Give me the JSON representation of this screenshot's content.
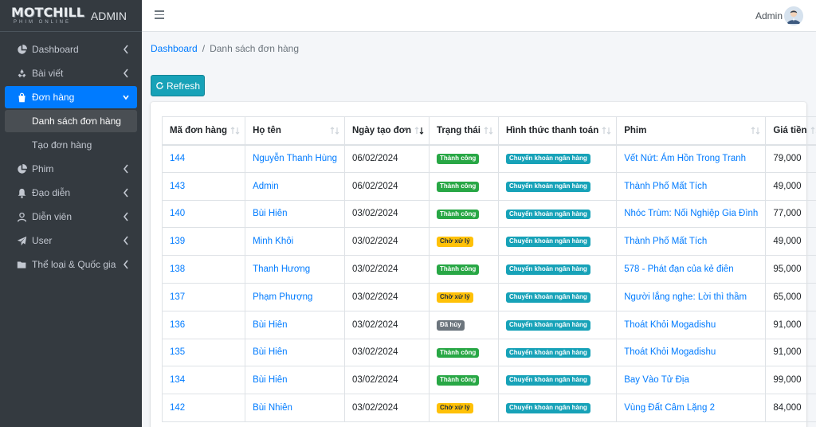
{
  "brand": {
    "logo_main": "MOTCHILL",
    "logo_sub": "PHIM ONLINE",
    "title": "ADMIN"
  },
  "topbar": {
    "user_name": "Admin"
  },
  "sidebar": {
    "items": [
      {
        "label": "Dashboard",
        "icon": "pie-chart-icon"
      },
      {
        "label": "Bài viết",
        "icon": "recycle-icon"
      },
      {
        "label": "Đơn hàng",
        "icon": "shopping-bag-icon",
        "active": true,
        "children": [
          {
            "label": "Danh sách đơn hàng",
            "active": true
          },
          {
            "label": "Tạo đơn hàng"
          }
        ]
      },
      {
        "label": "Phim",
        "icon": "pie-chart-icon"
      },
      {
        "label": "Đạo diễn",
        "icon": "bell-icon"
      },
      {
        "label": "Diễn viên",
        "icon": "user-icon"
      },
      {
        "label": "User",
        "icon": "paper-plane-icon"
      },
      {
        "label": "Thể loại & Quốc gia",
        "icon": "folder-icon"
      }
    ]
  },
  "breadcrumb": {
    "home": "Dashboard",
    "separator": "/",
    "current": "Danh sách đơn hàng"
  },
  "actions": {
    "refresh_label": "Refresh"
  },
  "table": {
    "headers": [
      "Mã đơn hàng",
      "Họ tên",
      "Ngày tạo đơn",
      "Trạng thái",
      "Hình thức thanh toán",
      "Phim",
      "Giá tiền"
    ],
    "rows": [
      {
        "id": "144",
        "name": "Nguyễn Thanh Hùng",
        "date": "06/02/2024",
        "status": "Thành công",
        "status_type": "success",
        "payment": "Chuyển khoản ngân hàng",
        "movie": "Vết Nứt: Ám Hồn Trong Tranh",
        "price": "79,000"
      },
      {
        "id": "143",
        "name": "Admin",
        "date": "06/02/2024",
        "status": "Thành công",
        "status_type": "success",
        "payment": "Chuyển khoản ngân hàng",
        "movie": "Thành Phố Mất Tích",
        "price": "49,000"
      },
      {
        "id": "140",
        "name": "Bùi Hiên",
        "date": "03/02/2024",
        "status": "Thành công",
        "status_type": "success",
        "payment": "Chuyển khoản ngân hàng",
        "movie": "Nhóc Trùm: Nối Nghiệp Gia Đình",
        "price": "77,000"
      },
      {
        "id": "139",
        "name": "Minh Khôi",
        "date": "03/02/2024",
        "status": "Chờ xử lý",
        "status_type": "warning",
        "payment": "Chuyển khoản ngân hàng",
        "movie": "Thành Phố Mất Tích",
        "price": "49,000"
      },
      {
        "id": "138",
        "name": "Thanh Hương",
        "date": "03/02/2024",
        "status": "Thành công",
        "status_type": "success",
        "payment": "Chuyển khoản ngân hàng",
        "movie": "578 - Phát đạn của kẻ điên",
        "price": "95,000"
      },
      {
        "id": "137",
        "name": "Phạm Phượng",
        "date": "03/02/2024",
        "status": "Chờ xử lý",
        "status_type": "warning",
        "payment": "Chuyển khoản ngân hàng",
        "movie": "Người lắng nghe: Lời thì thầm",
        "price": "65,000"
      },
      {
        "id": "136",
        "name": "Bùi Hiên",
        "date": "03/02/2024",
        "status": "Đã hủy",
        "status_type": "secondary",
        "payment": "Chuyển khoản ngân hàng",
        "movie": "Thoát Khỏi Mogadishu",
        "price": "91,000"
      },
      {
        "id": "135",
        "name": "Bùi Hiên",
        "date": "03/02/2024",
        "status": "Thành công",
        "status_type": "success",
        "payment": "Chuyển khoản ngân hàng",
        "movie": "Thoát Khỏi Mogadishu",
        "price": "91,000"
      },
      {
        "id": "134",
        "name": "Bùi Hiên",
        "date": "03/02/2024",
        "status": "Thành công",
        "status_type": "success",
        "payment": "Chuyển khoản ngân hàng",
        "movie": "Bay Vào Tử Địa",
        "price": "99,000"
      },
      {
        "id": "142",
        "name": "Bùi Nhiên",
        "date": "03/02/2024",
        "status": "Chờ xử lý",
        "status_type": "warning",
        "payment": "Chuyển khoản ngân hàng",
        "movie": "Vùng Đất Câm Lặng 2",
        "price": "84,000"
      }
    ]
  },
  "colors": {
    "primary": "#007bff",
    "info": "#17a2b8",
    "success": "#28a745",
    "warning": "#ffc107",
    "secondary": "#6c757d",
    "sidebar": "#343a40"
  }
}
